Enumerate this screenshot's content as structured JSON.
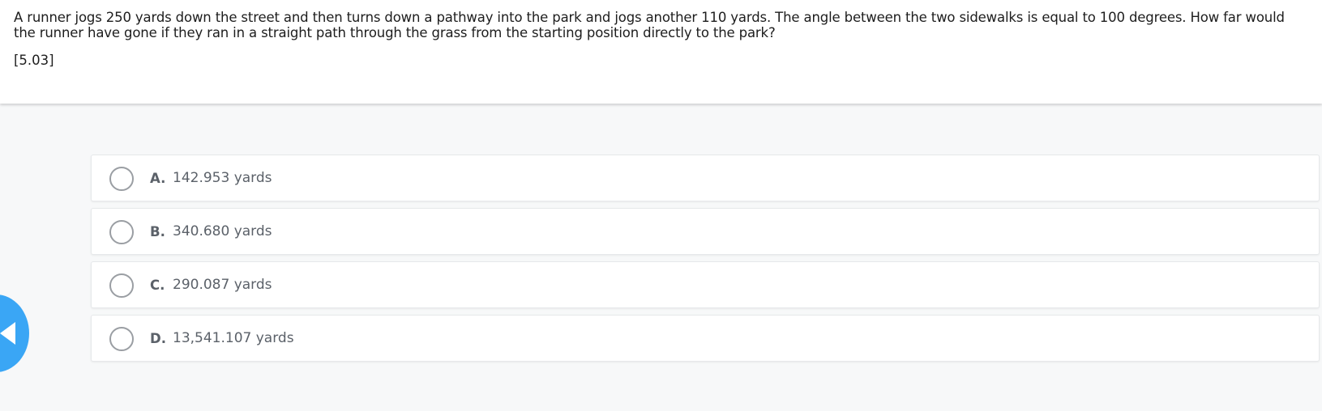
{
  "question": {
    "text": "A runner jogs 250 yards down the street and then turns down a pathway into the park and jogs another 110 yards. The angle between the two sidewalks is equal to 100 degrees. How far would the runner have gone if they ran in a straight path through the grass from the starting position directly to the park?",
    "code": "[5.03]"
  },
  "options": [
    {
      "letter": "A.",
      "text": "142.953 yards"
    },
    {
      "letter": "B.",
      "text": "340.680 yards"
    },
    {
      "letter": "C.",
      "text": "290.087 yards"
    },
    {
      "letter": "D.",
      "text": "13,541.107 yards"
    }
  ],
  "nav": {
    "back_icon": "chevron-left-icon",
    "accent_color": "#3aa6f5"
  }
}
